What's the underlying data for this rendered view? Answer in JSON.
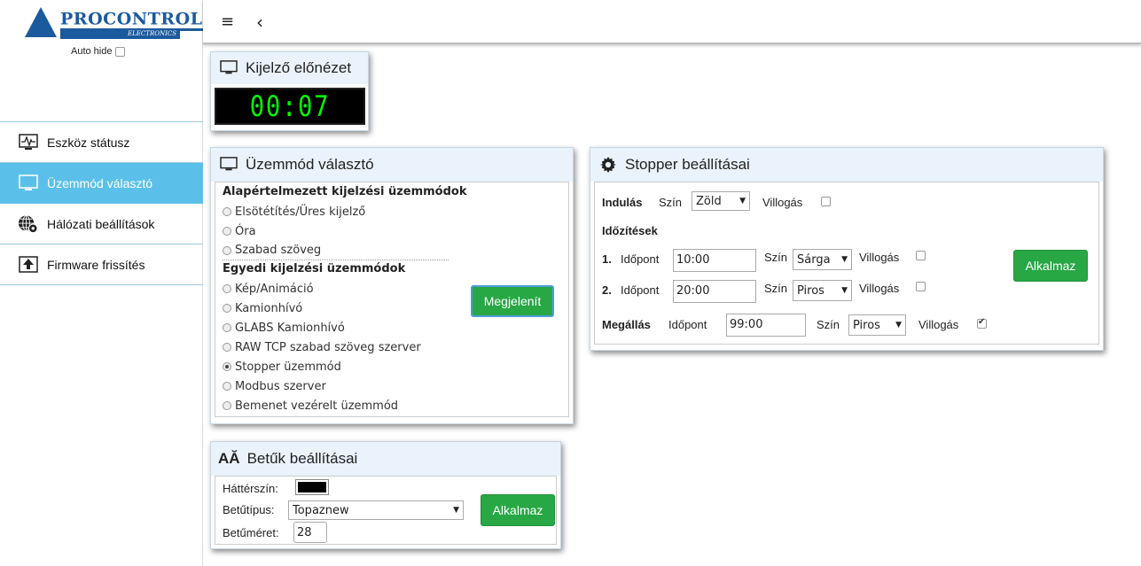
{
  "logo": {
    "name": "PROCONTROL",
    "sub": "ELECTRONICS",
    "mark": "®"
  },
  "sidebar": {
    "autohide_label": "Auto hide",
    "items": [
      {
        "label": "Eszköz státusz",
        "icon": "activity-monitor-icon"
      },
      {
        "label": "Üzemmód választó",
        "icon": "monitor-icon"
      },
      {
        "label": "Hálózati beállítások",
        "icon": "globe-gear-icon"
      },
      {
        "label": "Firmware frissítés",
        "icon": "upload-icon"
      }
    ]
  },
  "topbar": {
    "menu_icon": "≡",
    "back_icon": "‹"
  },
  "preview": {
    "title": "Kijelző előnézet",
    "display": "00:07"
  },
  "mode": {
    "title": "Üzemmód választó",
    "group1": "Alapértelmezett kijelzési üzemmódok",
    "group1_items": [
      "Elsötétítés/Üres kijelző",
      "Óra",
      "Szabad szöveg"
    ],
    "group2": "Egyedi kijelzési üzemmódok",
    "group2_items": [
      "Kép/Animáció",
      "Kamionhívó",
      "GLABS Kamionhívó",
      "RAW TCP szabad szöveg szerver",
      "Stopper üzemmód",
      "Modbus szerver",
      "Bemenet vezérelt üzemmód"
    ],
    "selected": "Stopper üzemmód",
    "button": "Megjelenít"
  },
  "fonts": {
    "title": "Betűk beállításai",
    "title_icon": "AĂ",
    "bg_label": "Háttérszín:",
    "bg_color": "#000000",
    "font_label": "Betűtípus:",
    "font_value": "Topaznew",
    "size_label": "Betűméret:",
    "size_value": "28",
    "button": "Alkalmaz"
  },
  "stopper": {
    "title": "Stopper beállításai",
    "start_label": "Indulás",
    "color_label": "Szín",
    "blink_label": "Villogás",
    "start_color": "Zöld",
    "timings_label": "Időzítések",
    "time_label": "Időpont",
    "t1_num": "1.",
    "t1_time": "10:00",
    "t1_color": "Sárga",
    "t2_num": "2.",
    "t2_time": "20:00",
    "t2_color": "Piros",
    "stop_label": "Megállás",
    "stop_time": "99:00",
    "stop_color": "Piros",
    "button": "Alkalmaz"
  },
  "colors": {
    "accent": "#5bc0e9",
    "button": "#28a745",
    "brand": "#1c5a9e",
    "display": "#00ff00"
  }
}
